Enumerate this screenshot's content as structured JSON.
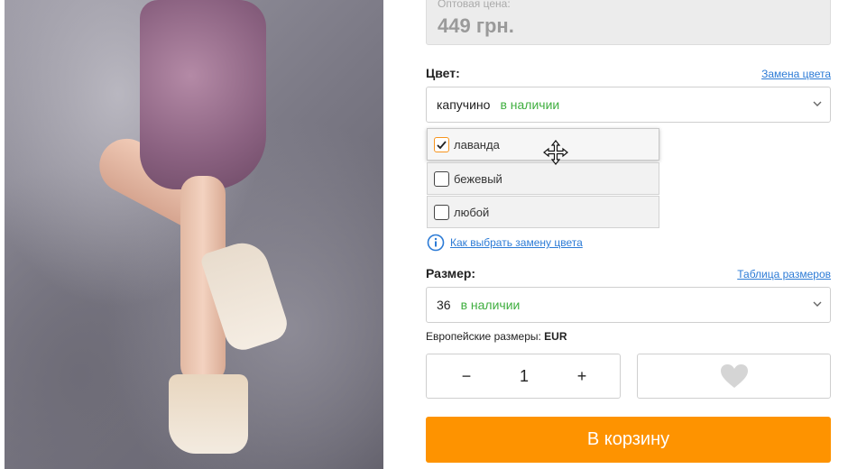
{
  "price": {
    "label": "Оптовая цена:",
    "value": "449 грн."
  },
  "color": {
    "label": "Цвет:",
    "replace_link": "Замена цвета",
    "selected": "капучино",
    "stock": "в наличии",
    "options": [
      {
        "label": "лаванда",
        "checked": true
      },
      {
        "label": "бежевый",
        "checked": false
      },
      {
        "label": "любой",
        "checked": false
      }
    ],
    "help_link": "Как выбрать замену цвета"
  },
  "size": {
    "label": "Размер:",
    "table_link": "Таблица размеров",
    "selected": "36",
    "stock": "в наличии",
    "note_prefix": "Европейские размеры: ",
    "note_bold": "EUR"
  },
  "quantity": {
    "minus": "−",
    "value": "1",
    "plus": "+"
  },
  "cart_button": "В корзину",
  "colors": {
    "accent": "#fe9300",
    "stock_green": "#3fae3f",
    "link_blue": "#2c7bd6",
    "check_orange": "#f7941d"
  },
  "icons": [
    "chevron-down-icon",
    "checkmark-icon",
    "info-icon",
    "heart-icon",
    "move-cursor-icon"
  ]
}
